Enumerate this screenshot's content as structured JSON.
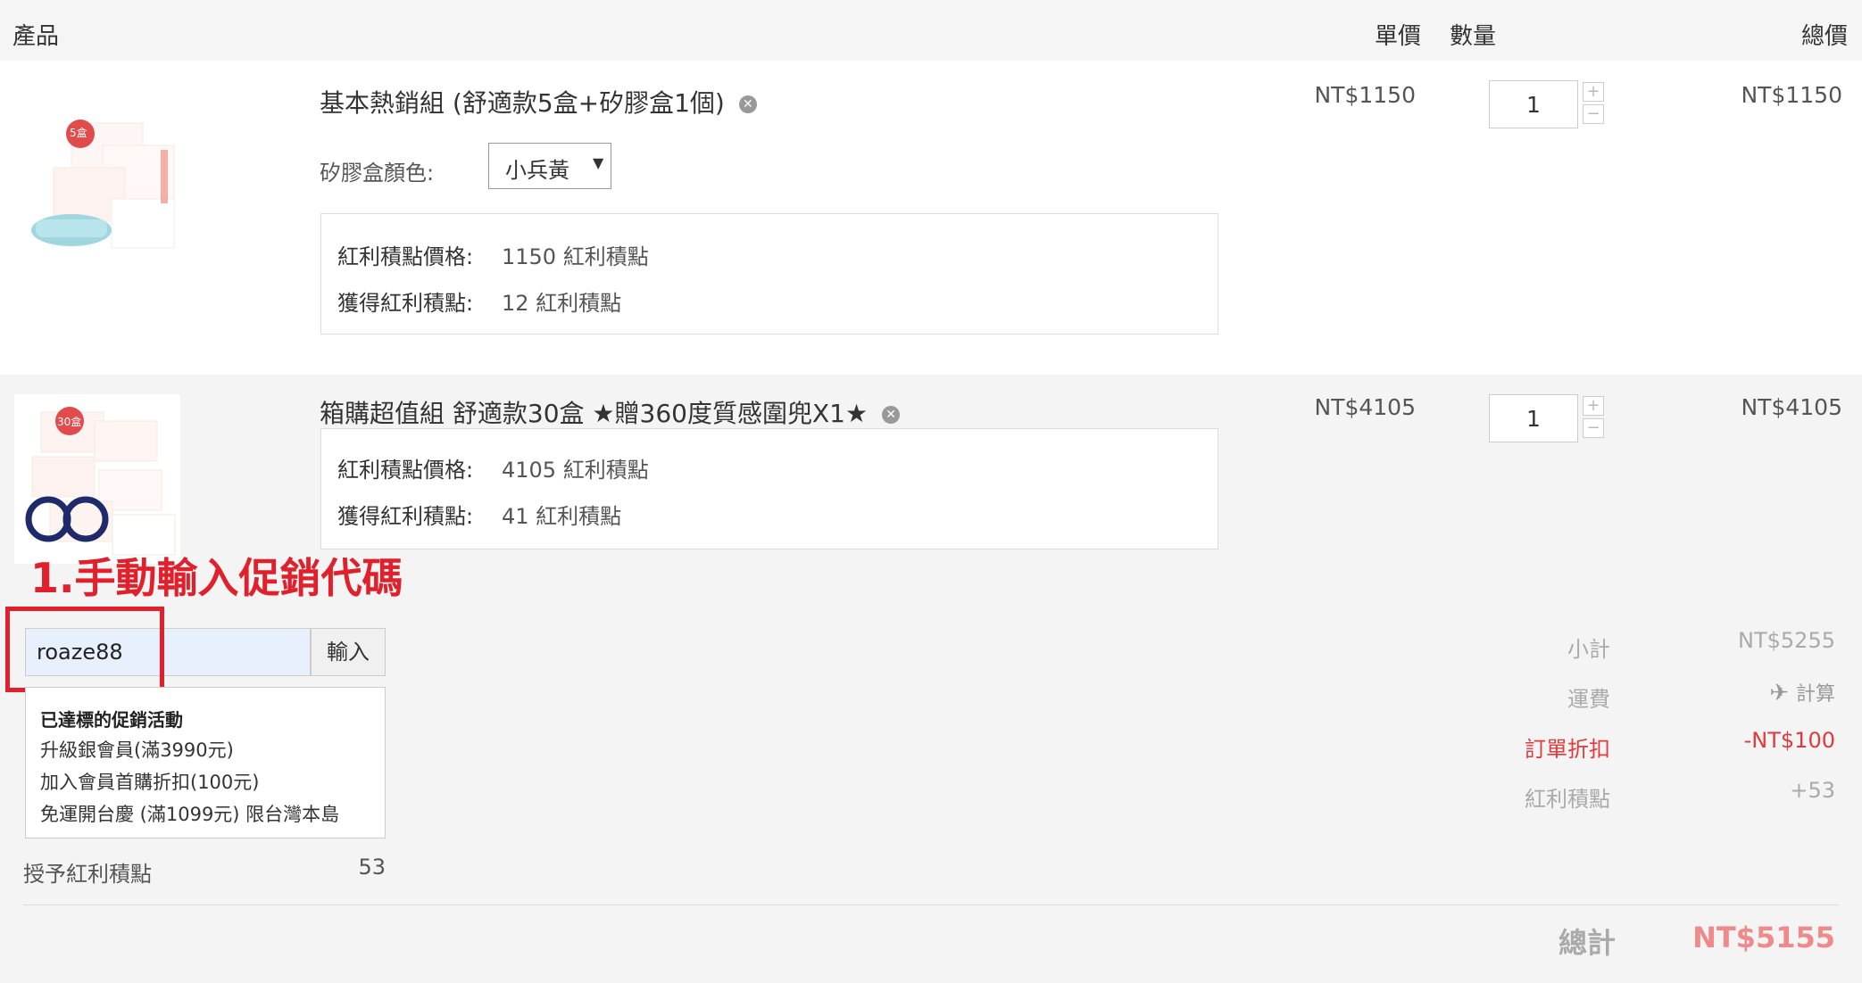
{
  "header": {
    "product": "產品",
    "unit_price": "單價",
    "quantity": "數量",
    "total": "總價"
  },
  "items": [
    {
      "title": "基本熱銷組 (舒適款5盒+矽膠盒1個)",
      "option_label": "矽膠盒顏色:",
      "option_value": "小兵黃",
      "image_badge": "5盒",
      "bonus_price_label": "紅利積點價格:",
      "bonus_price_value": "1150 紅利積點",
      "bonus_earn_label": "獲得紅利積點:",
      "bonus_earn_value": "12 紅利積點",
      "unit_price": "NT$1150",
      "quantity": "1",
      "total": "NT$1150"
    },
    {
      "title": "箱購超值組 舒適款30盒 ★贈360度質感圍兜X1★",
      "image_badge": "30盒",
      "bonus_price_label": "紅利積點價格:",
      "bonus_price_value": "4105 紅利積點",
      "bonus_earn_label": "獲得紅利積點:",
      "bonus_earn_value": "41 紅利積點",
      "unit_price": "NT$4105",
      "quantity": "1",
      "total": "NT$4105"
    }
  ],
  "annotation": "1.手動輸入促銷代碼",
  "promo": {
    "input_value": "roaze88",
    "apply_label": "輸入",
    "dropdown_title": "已達標的促銷活動",
    "options": [
      "升級銀會員(滿3990元)",
      "加入會員首購折扣(100元)",
      "免運開台慶 (滿1099元) 限台灣本島"
    ]
  },
  "grant_points": {
    "label": "授予紅利積點",
    "value": "53"
  },
  "summary": {
    "subtotal_label": "小計",
    "subtotal_value": "NT$5255",
    "shipping_label": "運費",
    "shipping_value": "計算",
    "discount_label": "訂單折扣",
    "discount_value": "-NT$100",
    "points_label": "紅利積點",
    "points_value": "+53",
    "total_label": "總計",
    "total_value": "NT$5155"
  },
  "colors": {
    "accent_red": "#e03a3a",
    "total_pink": "#f08a8a",
    "annotation_red": "#e0202a"
  }
}
